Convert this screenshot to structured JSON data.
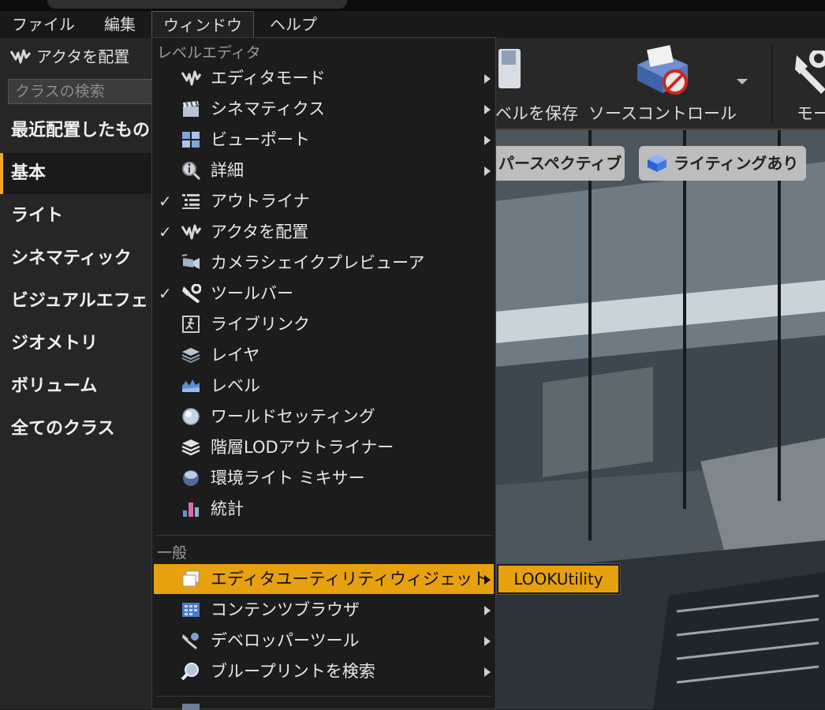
{
  "menubar": {
    "items": [
      {
        "label": "ファイル"
      },
      {
        "label": "編集"
      },
      {
        "label": "ウィンドウ"
      },
      {
        "label": "ヘルプ"
      }
    ]
  },
  "left_panel": {
    "title": "アクタを配置",
    "search_placeholder": "クラスの検索",
    "categories": [
      {
        "label": "最近配置したもの"
      },
      {
        "label": "基本"
      },
      {
        "label": "ライト"
      },
      {
        "label": "シネマティック"
      },
      {
        "label": "ビジュアルエフェ"
      },
      {
        "label": "ジオメトリ"
      },
      {
        "label": "ボリューム"
      },
      {
        "label": "全てのクラス"
      }
    ],
    "selected_category": "基本"
  },
  "toolbar": {
    "save_label": "ベルを保存",
    "source_control_label": "ソースコントロール",
    "modes_label": "モー"
  },
  "viewport": {
    "perspective_label": "パースペクティブ",
    "lighting_label": "ライティングあり"
  },
  "dropdown": {
    "section_level_editor": "レベルエディタ",
    "section_general": "一般",
    "items_level": [
      {
        "label": "エディタモード",
        "checked": false,
        "submenu": true,
        "icon": "modes-icon"
      },
      {
        "label": "シネマティクス",
        "checked": false,
        "submenu": true,
        "icon": "clapper-icon"
      },
      {
        "label": "ビューポート",
        "checked": false,
        "submenu": true,
        "icon": "viewport-icon"
      },
      {
        "label": "詳細",
        "checked": false,
        "submenu": true,
        "icon": "details-icon"
      },
      {
        "label": "アウトライナ",
        "checked": true,
        "submenu": false,
        "icon": "outliner-icon"
      },
      {
        "label": "アクタを配置",
        "checked": true,
        "submenu": false,
        "icon": "place-actors-icon"
      },
      {
        "label": "カメラシェイクプレビューア",
        "checked": false,
        "submenu": false,
        "icon": "camera-shake-icon"
      },
      {
        "label": "ツールバー",
        "checked": true,
        "submenu": false,
        "icon": "toolbar-wrench-icon"
      },
      {
        "label": "ライブリンク",
        "checked": false,
        "submenu": false,
        "icon": "livelink-icon"
      },
      {
        "label": "レイヤ",
        "checked": false,
        "submenu": false,
        "icon": "layers-icon"
      },
      {
        "label": "レベル",
        "checked": false,
        "submenu": false,
        "icon": "levels-icon"
      },
      {
        "label": "ワールドセッティング",
        "checked": false,
        "submenu": false,
        "icon": "world-settings-icon"
      },
      {
        "label": "階層LODアウトライナー",
        "checked": false,
        "submenu": false,
        "icon": "hlod-icon"
      },
      {
        "label": "環境ライト ミキサー",
        "checked": false,
        "submenu": false,
        "icon": "env-light-icon"
      },
      {
        "label": "統計",
        "checked": false,
        "submenu": false,
        "icon": "stats-icon"
      }
    ],
    "items_general": [
      {
        "label": "エディタユーティリティウィジェット",
        "submenu": true,
        "highlighted": true,
        "icon": "utility-widget-icon"
      },
      {
        "label": "コンテンツブラウザ",
        "submenu": true,
        "highlighted": false,
        "icon": "content-browser-icon"
      },
      {
        "label": "デベロッパーツール",
        "submenu": true,
        "highlighted": false,
        "icon": "developer-tools-icon"
      },
      {
        "label": "ブループリントを検索",
        "submenu": true,
        "highlighted": false,
        "icon": "find-blueprint-icon"
      }
    ]
  },
  "submenu": {
    "items": [
      {
        "label": "LOOKUtility"
      }
    ]
  },
  "colors": {
    "highlight": "#e8a10e",
    "accent_line": "#f0a820"
  }
}
